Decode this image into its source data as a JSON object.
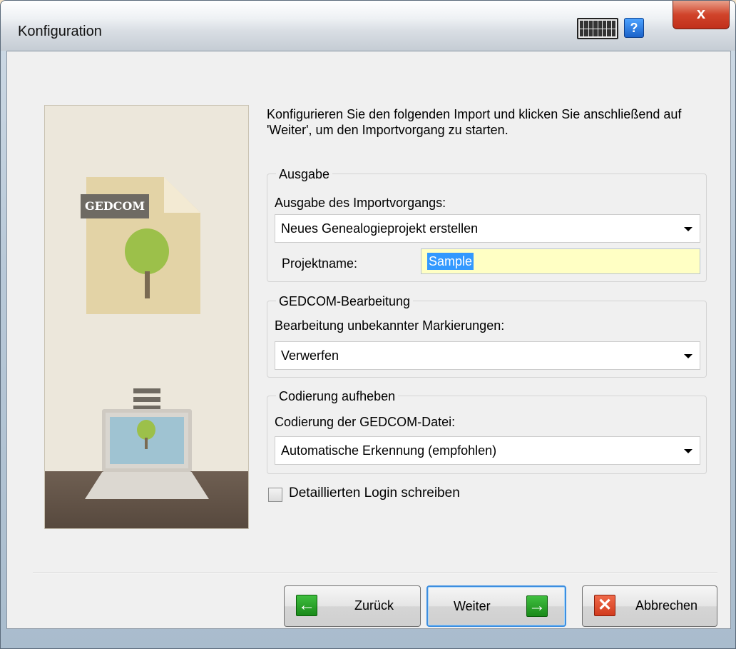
{
  "window": {
    "title": "Konfiguration"
  },
  "intro_text": "Konfigurieren Sie den folgenden Import und klicken Sie anschließend auf 'Weiter', um den Importvorgang zu starten.",
  "illustration": {
    "badge_text": "GEDCOM"
  },
  "output_group": {
    "legend": "Ausgabe",
    "label": "Ausgabe des Importvorgangs:",
    "selected": "Neues Genealogieprojekt erstellen",
    "project_label": "Projektname:",
    "project_value": "Sample"
  },
  "gedcom_group": {
    "legend": "GEDCOM-Bearbeitung",
    "label": "Bearbeitung unbekannter Markierungen:",
    "selected": "Verwerfen"
  },
  "encoding_group": {
    "legend": "Codierung aufheben",
    "label": "Codierung der GEDCOM-Datei:",
    "selected": "Automatische Erkennung (empfohlen)"
  },
  "checkbox": {
    "label": "Detaillierten Login schreiben",
    "checked": false
  },
  "buttons": {
    "back": "Zurück",
    "next": "Weiter",
    "cancel": "Abbrechen"
  },
  "colors": {
    "accent": "#3399ff",
    "input_highlight": "#ffffc4",
    "close_button": "#c1301b"
  }
}
